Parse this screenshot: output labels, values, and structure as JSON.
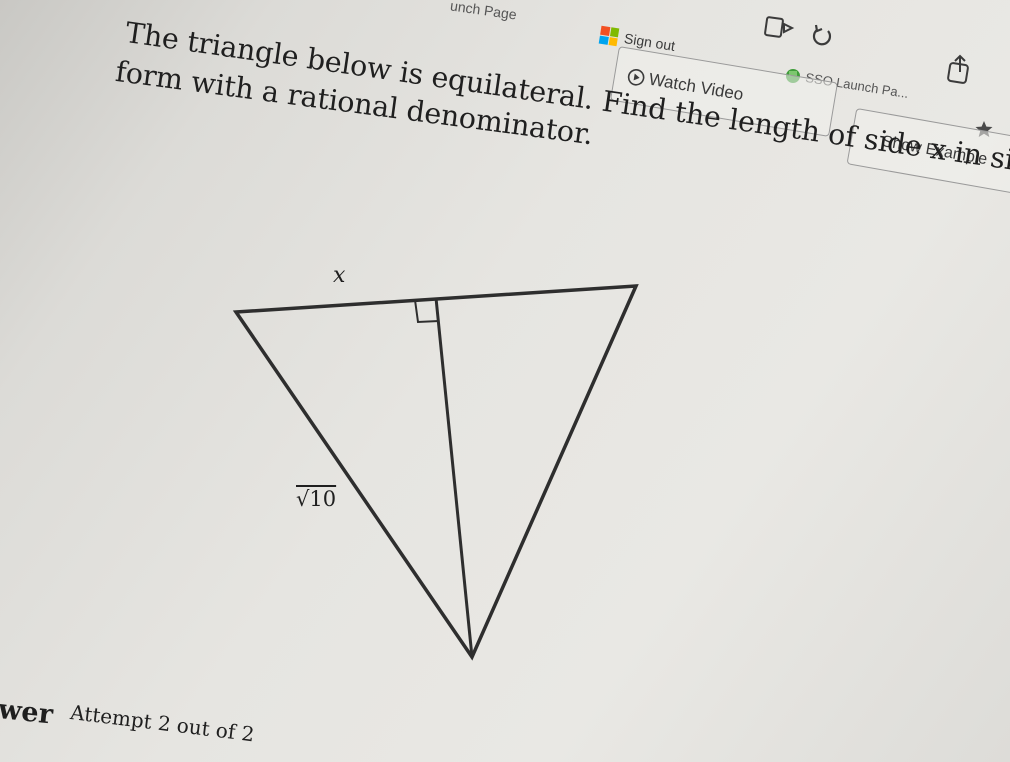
{
  "toolbar": {
    "launch_page": "unch Page",
    "sign_out": "Sign out",
    "sso": "SSO Launch Pa...",
    "watch_video": "Watch Video",
    "show_examples": "Show Example"
  },
  "question": {
    "line1": "The triangle below is equilateral. Find the length of side x in simplest radical",
    "line2": "form with a rational denominator."
  },
  "figure": {
    "side_label": "x",
    "height_label": "√10"
  },
  "footer": {
    "answer_fragment": "wer",
    "attempt": "Attempt 2 out of 2"
  },
  "icons": [
    "microsoft-logo-icon",
    "sso-app-icon",
    "play-circle-icon",
    "mirror-icon",
    "refresh-icon",
    "share-icon",
    "star-icon",
    "right-angle-marker"
  ]
}
